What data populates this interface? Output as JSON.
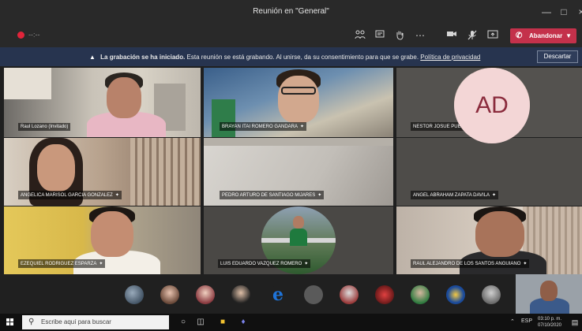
{
  "window": {
    "title": "Reunión en \"General\""
  },
  "controls": {
    "timer": "--:--",
    "leave_label": "Abandonar"
  },
  "banner": {
    "bold": "La grabación se ha iniciado.",
    "message": "Esta reunión se está grabando. Al unirse, da su consentimiento para que se grabe.",
    "link": "Política de privacidad",
    "dismiss_label": "Descartar"
  },
  "participants": [
    {
      "name": "Raul Lozano (Invitado)",
      "muted": false
    },
    {
      "name": "BRAYAN ITAI ROMERO GANDARA",
      "muted": true
    },
    {
      "name": "NESTOR JOSUE PUENTES INCHAURREGUI",
      "muted": true
    },
    {
      "name": "ANGELICA MARISOL GARCIA GONZALEZ",
      "muted": true
    },
    {
      "name": "PEDRO ARTURO DE SANTIAGO MIJARES",
      "muted": true
    },
    {
      "name": "ANGEL ABRAHAM ZAPATA DAVILA",
      "muted": true,
      "initials": "AD"
    },
    {
      "name": "EZEQUIEL RODRIGUEZ ESPARZA",
      "muted": true
    },
    {
      "name": "LUIS EDUARDO VAZQUEZ ROMERO",
      "muted": true
    },
    {
      "name": "RAUL ALEJANDRO DE LOS SANTOS ANGUIANO",
      "muted": true
    }
  ],
  "taskbar": {
    "search_placeholder": "Escribe aquí para buscar",
    "lang": "ESP",
    "time": "03:10 p. m.",
    "date": "07/10/2020"
  },
  "colors": {
    "leave": "#c4314b",
    "banner": "#27344f",
    "titlebar": "#292929"
  }
}
